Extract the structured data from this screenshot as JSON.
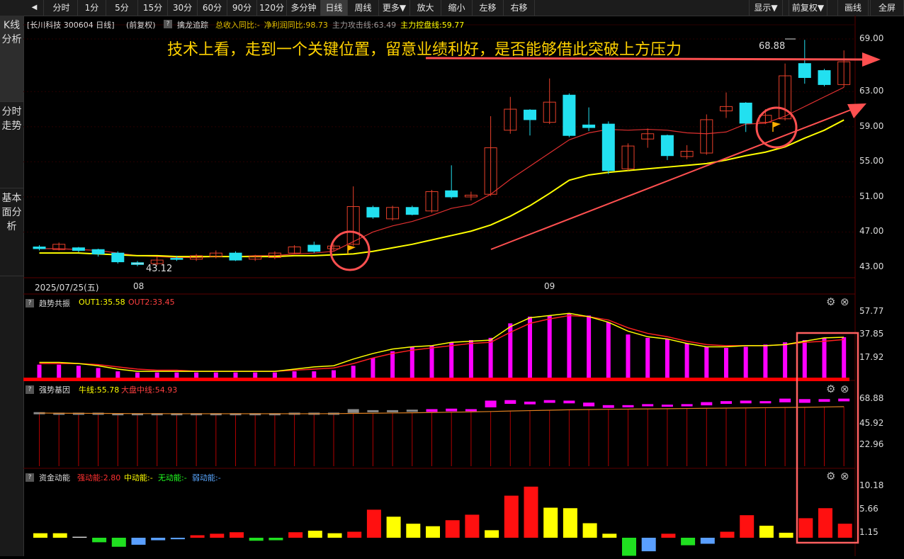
{
  "toolbar": {
    "buttons": [
      "分时",
      "1分",
      "5分",
      "15分",
      "30分",
      "60分",
      "90分",
      "120分",
      "多分钟",
      "日线",
      "周线",
      "更多▼",
      "放大",
      "缩小",
      "左移",
      "右移"
    ],
    "right_buttons": [
      "显示▼",
      "前复权▼",
      "画线",
      "全屏"
    ],
    "active": "日线"
  },
  "sidebar": {
    "tabs": [
      {
        "label": "K线分析",
        "active": true
      },
      {
        "label": "分时走势",
        "active": false
      },
      {
        "label": "基本面分析",
        "active": false
      }
    ]
  },
  "main": {
    "stock_title": "[长川科技 300604 日线]",
    "adjust": "(前复权)",
    "indicator_name": "擒龙追踪",
    "indicators": [
      {
        "text": "总收入同比:-",
        "color": "#e0c000"
      },
      {
        "text": "净利润同比:98.73",
        "color": "#e0c000"
      },
      {
        "text": "主力攻击线:63.49",
        "color": "#9a9a9a"
      },
      {
        "text": "主力控盘线:59.77",
        "color": "#ffff00"
      }
    ],
    "annotation": "技术上看，走到一个关键位置，留意业绩利好，是否能够借此突破上方压力",
    "high_label": "68.88",
    "low_label": "43.12",
    "yaxis": [
      "69.00",
      "63.00",
      "59.00",
      "55.00",
      "51.00",
      "47.00",
      "43.00"
    ],
    "dates": [
      "2025/07/25(五)",
      "08",
      "09"
    ]
  },
  "panels": {
    "trend": {
      "name": "趋势共振",
      "out1": "OUT1:35.58",
      "out2": "OUT2:33.45",
      "yaxis": [
        "57.77",
        "37.85",
        "17.92"
      ]
    },
    "gene": {
      "name": "强势基因",
      "niu": "牛线:55.78",
      "dapan": "大盘中线:54.93",
      "yaxis": [
        "68.88",
        "45.92",
        "22.96"
      ]
    },
    "fund": {
      "name": "资金动能",
      "strong": "强动能:2.80",
      "mid": "中动能:-",
      "none": "无动能:-",
      "weak": "弱动能:-",
      "yaxis": [
        "10.18",
        "5.66",
        "1.15"
      ]
    }
  },
  "chart_data": {
    "type": "candlestick",
    "candles": [
      {
        "o": 45.3,
        "c": 45.1,
        "h": 45.5,
        "l": 44.9
      },
      {
        "o": 45.0,
        "c": 45.6,
        "h": 45.8,
        "l": 44.9
      },
      {
        "o": 45.2,
        "c": 44.9,
        "h": 45.3,
        "l": 44.7
      },
      {
        "o": 45.0,
        "c": 44.5,
        "h": 45.1,
        "l": 44.2
      },
      {
        "o": 44.6,
        "c": 43.6,
        "h": 44.8,
        "l": 43.4
      },
      {
        "o": 43.5,
        "c": 43.3,
        "h": 43.7,
        "l": 43.1
      },
      {
        "o": 43.4,
        "c": 43.8,
        "h": 44.2,
        "l": 43.2
      },
      {
        "o": 44.0,
        "c": 43.9,
        "h": 44.3,
        "l": 43.7
      },
      {
        "o": 43.9,
        "c": 44.3,
        "h": 44.5,
        "l": 43.7
      },
      {
        "o": 44.2,
        "c": 44.6,
        "h": 44.9,
        "l": 44.0
      },
      {
        "o": 44.6,
        "c": 43.8,
        "h": 44.8,
        "l": 43.7
      },
      {
        "o": 43.9,
        "c": 44.2,
        "h": 44.4,
        "l": 43.7
      },
      {
        "o": 44.1,
        "c": 44.6,
        "h": 44.8,
        "l": 43.9
      },
      {
        "o": 44.6,
        "c": 45.3,
        "h": 45.5,
        "l": 44.5
      },
      {
        "o": 45.5,
        "c": 44.8,
        "h": 45.9,
        "l": 44.6
      },
      {
        "o": 45.1,
        "c": 45.4,
        "h": 45.6,
        "l": 44.8
      },
      {
        "o": 45.6,
        "c": 49.9,
        "h": 52.2,
        "l": 45.4
      },
      {
        "o": 49.8,
        "c": 48.7,
        "h": 50.0,
        "l": 48.5
      },
      {
        "o": 48.5,
        "c": 49.8,
        "h": 50.0,
        "l": 48.3
      },
      {
        "o": 49.8,
        "c": 49.0,
        "h": 50.0,
        "l": 48.9
      },
      {
        "o": 49.4,
        "c": 51.6,
        "h": 51.8,
        "l": 49.2
      },
      {
        "o": 51.7,
        "c": 51.0,
        "h": 54.6,
        "l": 50.8
      },
      {
        "o": 51.0,
        "c": 51.2,
        "h": 51.6,
        "l": 50.6
      },
      {
        "o": 51.3,
        "c": 56.6,
        "h": 60.2,
        "l": 51.1
      },
      {
        "o": 58.6,
        "c": 61.0,
        "h": 62.4,
        "l": 58.2
      },
      {
        "o": 60.9,
        "c": 59.8,
        "h": 61.0,
        "l": 58.0
      },
      {
        "o": 59.5,
        "c": 61.8,
        "h": 64.5,
        "l": 59.3
      },
      {
        "o": 62.6,
        "c": 58.0,
        "h": 62.8,
        "l": 57.8
      },
      {
        "o": 59.2,
        "c": 58.9,
        "h": 61.2,
        "l": 58.5
      },
      {
        "o": 59.3,
        "c": 54.0,
        "h": 59.6,
        "l": 53.6
      },
      {
        "o": 54.2,
        "c": 56.8,
        "h": 57.1,
        "l": 54.0
      },
      {
        "o": 57.6,
        "c": 58.2,
        "h": 58.8,
        "l": 56.6
      },
      {
        "o": 58.0,
        "c": 55.7,
        "h": 58.1,
        "l": 55.2
      },
      {
        "o": 55.6,
        "c": 56.2,
        "h": 56.9,
        "l": 55.3
      },
      {
        "o": 56.0,
        "c": 59.8,
        "h": 60.4,
        "l": 55.8
      },
      {
        "o": 60.8,
        "c": 61.3,
        "h": 62.9,
        "l": 60.0
      },
      {
        "o": 61.7,
        "c": 59.4,
        "h": 61.8,
        "l": 58.4
      },
      {
        "o": 59.5,
        "c": 60.3,
        "h": 61.0,
        "l": 59.3
      },
      {
        "o": 59.9,
        "c": 64.8,
        "h": 66.2,
        "l": 59.7
      },
      {
        "o": 66.2,
        "c": 64.6,
        "h": 68.9,
        "l": 63.9
      },
      {
        "o": 65.4,
        "c": 63.8,
        "h": 65.6,
        "l": 63.6
      },
      {
        "o": 63.8,
        "c": 66.4,
        "h": 67.7,
        "l": 63.5
      }
    ],
    "attack_line": [
      45.1,
      45.1,
      45.0,
      44.9,
      44.6,
      44.3,
      44.2,
      44.1,
      44.1,
      44.2,
      44.2,
      44.3,
      44.3,
      44.5,
      44.6,
      44.8,
      45.9,
      47.0,
      47.7,
      48.2,
      48.9,
      49.7,
      50.1,
      51.3,
      53.0,
      54.5,
      56.0,
      57.5,
      58.3,
      58.7,
      58.6,
      58.7,
      58.6,
      58.3,
      58.2,
      58.4,
      59.3,
      59.4,
      60.2,
      61.3,
      62.4,
      63.49
    ],
    "control_line": [
      44.6,
      44.6,
      44.6,
      44.5,
      44.4,
      44.3,
      44.3,
      44.2,
      44.2,
      44.2,
      44.2,
      44.2,
      44.2,
      44.3,
      44.3,
      44.4,
      44.5,
      44.8,
      45.2,
      45.6,
      46.1,
      46.6,
      47.1,
      47.8,
      48.8,
      50.0,
      51.4,
      52.9,
      53.5,
      53.8,
      54.0,
      54.2,
      54.4,
      54.6,
      54.8,
      55.2,
      55.7,
      56.1,
      56.7,
      57.7,
      58.6,
      59.77
    ],
    "trend_bars": [
      11,
      11,
      10,
      8,
      5,
      4,
      4,
      4,
      4,
      4,
      4,
      4,
      4,
      5,
      5,
      6,
      10,
      17,
      23,
      27,
      28,
      31,
      33,
      35,
      48,
      54,
      55,
      57,
      55,
      49,
      38,
      35,
      34,
      30,
      27,
      26,
      27,
      29,
      31,
      33,
      35,
      35.58
    ],
    "trend_out1": [
      13,
      13,
      12,
      10,
      7,
      5,
      5,
      5,
      5,
      5,
      5,
      5,
      5,
      7,
      9,
      10,
      16,
      21,
      25,
      27,
      28,
      31,
      32,
      33,
      45,
      53,
      55,
      57,
      54,
      49,
      41,
      36,
      34,
      30,
      27,
      27,
      28,
      28,
      29,
      32,
      35,
      35.58
    ],
    "trend_out2": [
      12,
      12,
      12,
      11,
      9,
      7,
      6,
      6,
      5,
      5,
      5,
      5,
      5,
      6,
      7,
      8,
      12,
      17,
      21,
      24,
      26,
      28,
      30,
      31,
      40,
      48,
      52,
      55,
      54,
      51,
      44,
      39,
      36,
      32,
      29,
      28,
      28,
      28,
      29,
      31,
      32,
      33.45
    ],
    "gene_top": [
      56,
      55.5,
      55.5,
      55.5,
      55,
      55,
      55,
      55,
      55,
      55,
      55,
      55,
      55,
      55.5,
      55.5,
      55.5,
      59,
      58,
      58,
      58.5,
      59,
      59.5,
      59,
      67.5,
      68,
      66.5,
      68,
      67.5,
      65.5,
      63,
      63,
      64,
      63.5,
      64,
      66,
      67,
      67.5,
      67,
      69.5,
      69,
      69,
      69.5
    ],
    "gene_bot": [
      55,
      54.5,
      54.5,
      54.5,
      54,
      54,
      54,
      54,
      54,
      54,
      54,
      54,
      54,
      54.5,
      54.5,
      54.5,
      56,
      57,
      57.5,
      57,
      57,
      57.5,
      58,
      61.5,
      65,
      64.5,
      66,
      65.5,
      62.5,
      61,
      61.5,
      62.5,
      62.5,
      62.5,
      63.5,
      65,
      65.5,
      65.5,
      66.5,
      66,
      67,
      67.5
    ],
    "gene_color": [
      "gray",
      "gray",
      "gray",
      "gray",
      "gray",
      "gray",
      "gray",
      "gray",
      "gray",
      "gray",
      "gray",
      "gray",
      "gray",
      "gray",
      "gray",
      "gray",
      "gray",
      "gray",
      "gray",
      "gray",
      "mag",
      "mag",
      "mag",
      "mag",
      "mag",
      "mag",
      "mag",
      "mag",
      "mag",
      "mag",
      "mag",
      "mag",
      "mag",
      "mag",
      "mag",
      "mag",
      "mag",
      "mag",
      "mag",
      "mag",
      "mag",
      "mag"
    ],
    "niu_line": [
      55.5,
      55.3,
      55.2,
      55.1,
      55.0,
      54.9,
      54.9,
      54.8,
      54.8,
      54.8,
      54.8,
      54.8,
      54.8,
      54.8,
      54.8,
      54.9,
      55.1,
      55.3,
      55.5,
      55.7,
      56.0,
      56.3,
      56.6,
      57.0,
      57.5,
      57.9,
      58.3,
      58.7,
      59.0,
      59.2,
      59.4,
      59.6,
      59.8,
      60.0,
      60.2,
      60.4,
      60.6,
      60.8,
      61.0,
      61.2,
      61.5,
      61.8
    ],
    "fund": [
      0.9,
      0.9,
      0.2,
      -0.9,
      -1.8,
      -1.4,
      -0.5,
      -0.3,
      0.5,
      0.8,
      1.1,
      -0.6,
      -0.5,
      1.1,
      1.4,
      0.9,
      1.2,
      5.6,
      4.2,
      2.8,
      2.3,
      3.5,
      4.6,
      1.5,
      8.4,
      10.2,
      6.0,
      5.9,
      2.9,
      0.8,
      -3.6,
      -2.7,
      0.8,
      -1.5,
      -1.2,
      1.2,
      4.5,
      2.4,
      1.0,
      3.9,
      5.9,
      2.8
    ],
    "fund_color": [
      "yellow",
      "yellow",
      "white",
      "green",
      "green",
      "blue",
      "blue",
      "blue",
      "red",
      "red",
      "red",
      "green",
      "green",
      "red",
      "yellow",
      "yellow",
      "red",
      "red",
      "yellow",
      "yellow",
      "yellow",
      "red",
      "red",
      "yellow",
      "red",
      "red",
      "yellow",
      "yellow",
      "yellow",
      "yellow",
      "green",
      "blue",
      "red",
      "green",
      "blue",
      "red",
      "red",
      "yellow",
      "yellow",
      "red",
      "red",
      "red"
    ]
  },
  "colors": {
    "up": "#e8402a",
    "down": "#22e0f0",
    "bg": "#000000",
    "grid": "#5a0000",
    "control": "#ffff00",
    "attack": "#e03030",
    "magenta": "#ff00ff"
  }
}
